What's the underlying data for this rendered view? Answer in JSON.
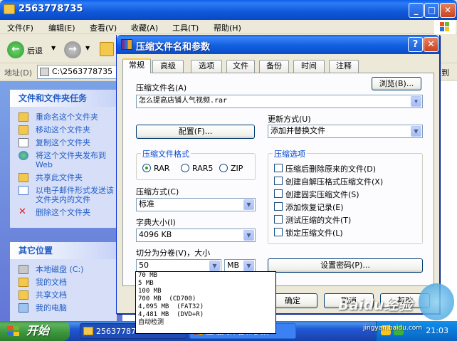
{
  "explorer": {
    "title": "2563778735",
    "menu": [
      "文件(F)",
      "编辑(E)",
      "查看(V)",
      "收藏(A)",
      "工具(T)",
      "帮助(H)"
    ],
    "back_label": "后退",
    "address_label": "地址(D)",
    "address_value": "C:\\2563778735",
    "goto_label": "到",
    "file_tasks": {
      "header": "文件和文件夹任务",
      "items": [
        "重命名这个文件夹",
        "移动这个文件夹",
        "复制这个文件夹",
        "将这个文件夹发布到 Web",
        "共享此文件夹",
        "以电子邮件形式发送该文件夹内的文件",
        "删除这个文件夹"
      ]
    },
    "other_places": {
      "header": "其它位置",
      "items": [
        "本地磁盘 (C:)",
        "我的文档",
        "共享文档",
        "我的电脑"
      ]
    }
  },
  "dialog": {
    "title": "压缩文件名和参数",
    "help_glyph": "?",
    "close_glyph": "✕",
    "tabs": [
      "常规",
      "高级",
      "选项",
      "文件",
      "备份",
      "时间",
      "注释"
    ],
    "archive_name_label": "压缩文件名(A)",
    "browse_button": "浏览(B)...",
    "archive_name_value": "怎么提高店铺人气视频.rar",
    "update_mode_label": "更新方式(U)",
    "update_mode_value": "添加并替换文件",
    "profile_button": "配置(F)...",
    "format_group": "压缩文件格式",
    "formats": [
      "RAR",
      "RAR5",
      "ZIP"
    ],
    "selected_format": "RAR",
    "method_label": "压缩方式(C)",
    "method_value": "标准",
    "dict_label": "字典大小(I)",
    "dict_value": "4096 KB",
    "split_label": "切分为分卷(V)，大小",
    "split_value": "50",
    "split_unit": "MB",
    "options_group": "压缩选项",
    "options": [
      "压缩后删除原来的文件(D)",
      "创建自解压格式压缩文件(X)",
      "创建固实压缩文件(S)",
      "添加恢复记录(E)",
      "测试压缩的文件(T)",
      "锁定压缩文件(L)"
    ],
    "password_button": "设置密码(P)...",
    "ok_button": "确定",
    "cancel_button": "取消",
    "help_button": "帮助"
  },
  "split_dropdown": [
    "70 MB",
    "5 MB",
    "100 MB",
    "700 MB  (CD700)",
    "4,095 MB  (FAT32)",
    "4,481 MB  (DVD+R)",
    "自动检测"
  ],
  "taskbar": {
    "start_label": "开始",
    "tasks": [
      "2563778735",
      "压缩文件名和参数"
    ],
    "clock": "21:03"
  },
  "watermark": {
    "brand": "Baidu经验",
    "url": "jingyan.baidu.com"
  },
  "colors": {
    "xp_blue": "#0A5FE8",
    "tab_accent": "#FFC83C",
    "group_title": "#0046D5",
    "link_blue": "#215DC6",
    "start_green": "#3A953A"
  }
}
